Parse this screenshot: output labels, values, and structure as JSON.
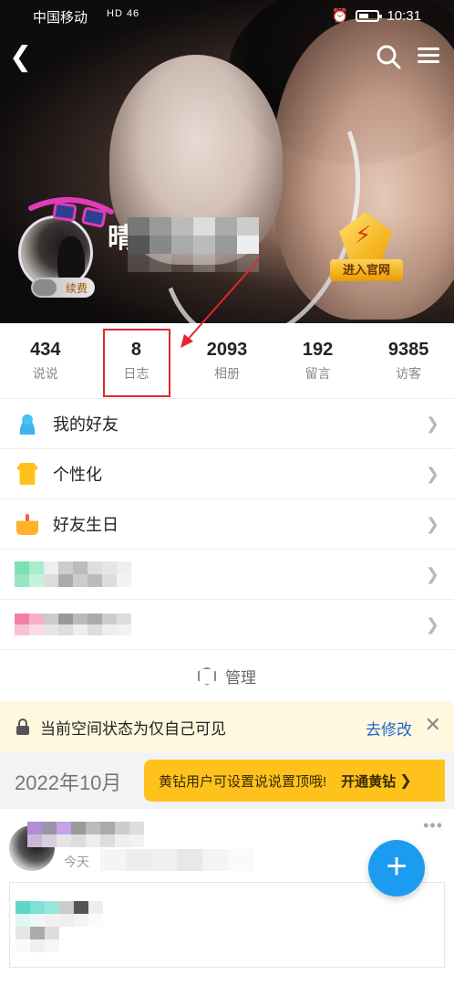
{
  "status_bar": {
    "carrier": "中国移动",
    "signal_text": "HD 46",
    "time": "10:31",
    "battery_level": 0.55
  },
  "header": {
    "username_visible_char": "晴",
    "renew_badge": "续费",
    "enter_official_label": "进入官网"
  },
  "stats": [
    {
      "value": "434",
      "label": "说说"
    },
    {
      "value": "8",
      "label": "日志"
    },
    {
      "value": "2093",
      "label": "相册"
    },
    {
      "value": "192",
      "label": "留言"
    },
    {
      "value": "9385",
      "label": "访客"
    }
  ],
  "menu": {
    "items": [
      {
        "label": "我的好友",
        "icon": "friends-icon"
      },
      {
        "label": "个性化",
        "icon": "tshirt-icon"
      },
      {
        "label": "好友生日",
        "icon": "cake-icon"
      }
    ],
    "manage_label": "管理"
  },
  "notice": {
    "text": "当前空间状态为仅自己可见",
    "action": "去修改",
    "close_glyph": "✕"
  },
  "timeline": {
    "month": "2022年10月",
    "promo_text": "黄钻用户可设置说说置顶哦!",
    "promo_button": "开通黄钻",
    "post_time_prefix": "今天"
  },
  "colors": {
    "accent_blue": "#1c9cf0",
    "promo_yellow": "#ffc21c",
    "highlight_red": "#e3262a",
    "link_blue": "#1d67c8"
  }
}
